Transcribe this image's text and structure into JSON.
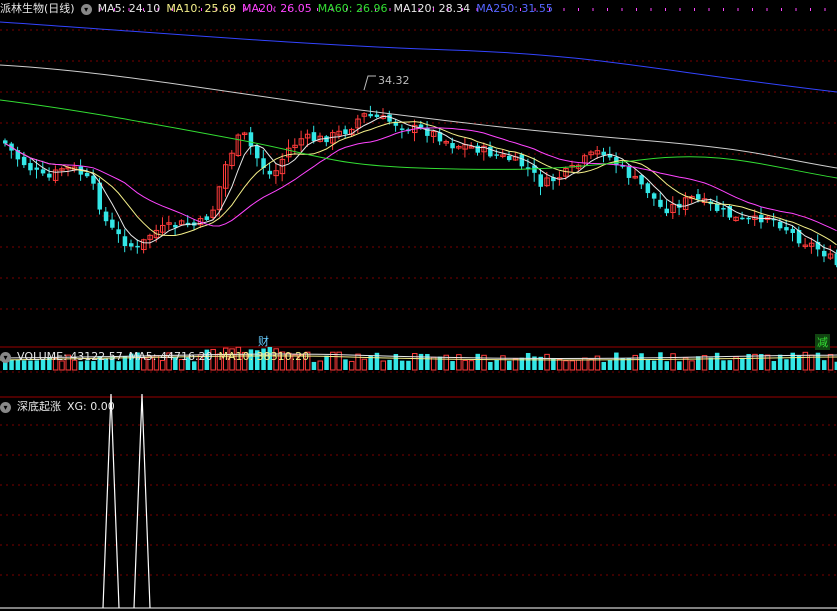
{
  "price_panel": {
    "title": "派林生物(日线)",
    "indicators": [
      {
        "label": "MA5: 24.10",
        "color": "#e8e8e8"
      },
      {
        "label": "MA10: 25.69",
        "color": "#f5f08a"
      },
      {
        "label": "MA20: 26.05",
        "color": "#ff44ff"
      },
      {
        "label": "MA60: 26.96",
        "color": "#33dd33"
      },
      {
        "label": "MA120: 28.34",
        "color": "#e8e8e8"
      },
      {
        "label": "MA250: 31.55",
        "color": "#5566ff"
      }
    ],
    "high_label": "34.32",
    "markers": [
      {
        "text": "财",
        "color": "#66ccff"
      },
      {
        "text": "减",
        "color": "#33dd33"
      }
    ]
  },
  "volume_panel": {
    "title": "VOLUME: 43122.57",
    "ma5": "MA5: 44716.20",
    "ma10": "MA10: 38310.20"
  },
  "signal_panel": {
    "title": "深底起涨",
    "xg": "XG: 0.00"
  },
  "colors": {
    "up": "#ff3b3b",
    "down": "#33e6e6",
    "grid": "#7a0000",
    "separator": "#9a0000"
  }
}
